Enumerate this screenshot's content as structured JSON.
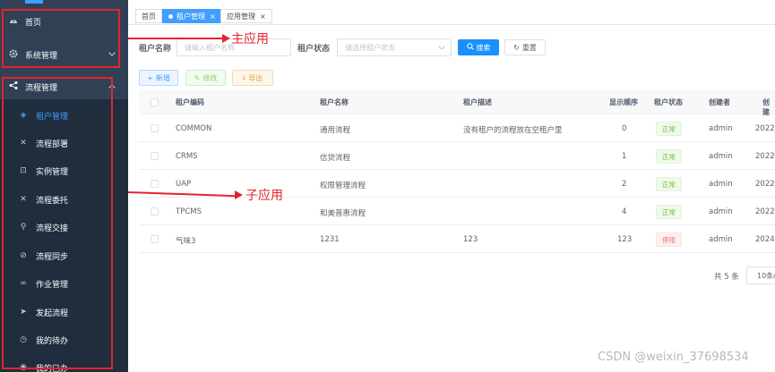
{
  "sidebar": {
    "top_items": [
      {
        "label": "首页",
        "icon": "dashboard-icon"
      },
      {
        "label": "系统管理",
        "icon": "gear-icon"
      }
    ],
    "submenu_title": "流程管理",
    "sub_items": [
      {
        "label": "租户管理",
        "icon": "layers-icon",
        "active": true
      },
      {
        "label": "流程部署",
        "icon": "tools-icon"
      },
      {
        "label": "实例管理",
        "icon": "instance-icon"
      },
      {
        "label": "流程委托",
        "icon": "tools-icon"
      },
      {
        "label": "流程交接",
        "icon": "handover-icon"
      },
      {
        "label": "流程同步",
        "icon": "sync-icon"
      },
      {
        "label": "作业管理",
        "icon": "job-icon"
      },
      {
        "label": "发起流程",
        "icon": "send-icon"
      },
      {
        "label": "我的待办",
        "icon": "clock-icon"
      },
      {
        "label": "我的已办",
        "icon": "done-icon"
      }
    ]
  },
  "tags": [
    {
      "label": "首页"
    },
    {
      "label": "租户管理",
      "active": true
    },
    {
      "label": "应用管理"
    }
  ],
  "form": {
    "code_label": "租户名称",
    "code_placeholder": "请输入租户名称",
    "status_label": "租户状态",
    "status_placeholder": "请选择租户状态",
    "search_label": "搜索",
    "reset_label": "重置"
  },
  "toolbar": {
    "add_label": "新增",
    "edit_label": "修改",
    "export_label": "导出"
  },
  "table": {
    "headers": [
      "租户编码",
      "租户名称",
      "租户描述",
      "显示顺序",
      "租户状态",
      "创建者",
      "创建"
    ],
    "rows": [
      {
        "code": "COMMON",
        "name": "通用流程",
        "desc": "没有租户的流程放在空租户里",
        "order": "0",
        "status": "正常",
        "status_type": "ok",
        "creator": "admin",
        "created": "2022-"
      },
      {
        "code": "CRMS",
        "name": "信贷流程",
        "desc": "",
        "order": "1",
        "status": "正常",
        "status_type": "ok",
        "creator": "admin",
        "created": "2022-"
      },
      {
        "code": "UAP",
        "name": "权限管理流程",
        "desc": "",
        "order": "2",
        "status": "正常",
        "status_type": "ok",
        "creator": "admin",
        "created": "2022-"
      },
      {
        "code": "TPCMS",
        "name": "和美普惠流程",
        "desc": "",
        "order": "4",
        "status": "正常",
        "status_type": "ok",
        "creator": "admin",
        "created": "2022-"
      },
      {
        "code": "气味3",
        "name": "1231",
        "desc": "123",
        "order": "123",
        "status": "停用",
        "status_type": "stop",
        "creator": "admin",
        "created": "2024-"
      }
    ]
  },
  "pager": {
    "total": "共 5 条",
    "size": "10条/"
  },
  "annotations": {
    "main_app": "主应用",
    "sub_app": "子应用"
  },
  "colors": {
    "sidebar_bg": "#304156",
    "submenu_bg": "#1f2d3d",
    "accent": "#409eff",
    "annotation": "#e3242b"
  },
  "watermark": "CSDN @weixin_37698534"
}
